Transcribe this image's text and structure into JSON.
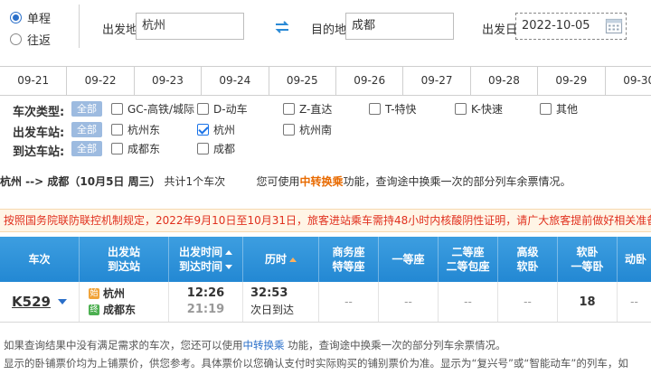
{
  "search": {
    "trip_types": [
      {
        "label": "单程",
        "selected": true
      },
      {
        "label": "往返",
        "selected": false
      }
    ],
    "from_label": "出发地",
    "from_value": "杭州",
    "to_label": "目的地",
    "to_value": "成都",
    "date_label": "出发日",
    "date_value": "2022-10-05",
    "swap_icon": "swap-arrows-icon",
    "calendar_icon": "calendar-icon"
  },
  "date_strip": [
    "09-21",
    "09-22",
    "09-23",
    "09-24",
    "09-25",
    "09-26",
    "09-27",
    "09-28",
    "09-29",
    "09-30"
  ],
  "filters": {
    "all_label": "全部",
    "train_type": {
      "label": "车次类型:",
      "options": [
        {
          "label": "GC-高铁/城际",
          "checked": false
        },
        {
          "label": "D-动车",
          "checked": false
        },
        {
          "label": "Z-直达",
          "checked": false
        },
        {
          "label": "T-特快",
          "checked": false
        },
        {
          "label": "K-快速",
          "checked": false
        },
        {
          "label": "其他",
          "checked": false
        }
      ]
    },
    "from_station": {
      "label": "出发车站:",
      "options": [
        {
          "label": "杭州东",
          "checked": false
        },
        {
          "label": "杭州",
          "checked": true
        },
        {
          "label": "杭州南",
          "checked": false
        }
      ]
    },
    "to_station": {
      "label": "到达车站:",
      "options": [
        {
          "label": "成都东",
          "checked": false
        },
        {
          "label": "成都",
          "checked": false
        }
      ]
    }
  },
  "summary": {
    "route": "杭州 --> 成都（10月5日  周三）",
    "count_prefix": "共计",
    "count": "1",
    "count_suffix": "个车次",
    "transfer_prefix": "您可使用",
    "transfer_link": "中转换乘",
    "transfer_suffix": "功能，查询途中换乘一次的部分列车余票情况。"
  },
  "notice": "按照国务院联防联控机制规定，2022年9月10日至10月31日，旅客进站乘车需持48小时内核酸阴性证明，请广大旅客提前做好相关准备",
  "table": {
    "headers": {
      "train": "车次",
      "stations_1": "出发站",
      "stations_2": "到达站",
      "times_1": "出发时间",
      "times_2": "到达时间",
      "duration": "历时",
      "business_1": "商务座",
      "business_2": "特等座",
      "first": "一等座",
      "second_1": "二等座",
      "second_2": "二等包座",
      "soft_premium_1": "高级",
      "soft_premium_2": "软卧",
      "soft_1": "软卧",
      "soft_2": "一等卧",
      "moving": "动卧"
    },
    "rows": [
      {
        "train_no": "K529",
        "from_station": "杭州",
        "from_badge": "始",
        "to_station": "成都东",
        "to_badge": "终",
        "depart": "12:26",
        "arrive": "21:19",
        "duration": "32:53",
        "arrive_day": "次日到达",
        "business": "--",
        "first": "--",
        "second": "--",
        "soft_premium": "--",
        "soft": "18",
        "moving": "--"
      }
    ]
  },
  "footer": {
    "line1_prefix": "如果查询结果中没有满足需求的车次，您还可以使用",
    "line1_link": "中转换乘",
    "line1_suffix": " 功能，查询途中换乘一次的部分列车余票情况。",
    "line2": "显示的卧铺票价均为上铺票价，供您参考。具体票价以您确认支付时实际购买的铺别票价为准。显示为“复兴号”或“智能动车”的列车，如"
  }
}
